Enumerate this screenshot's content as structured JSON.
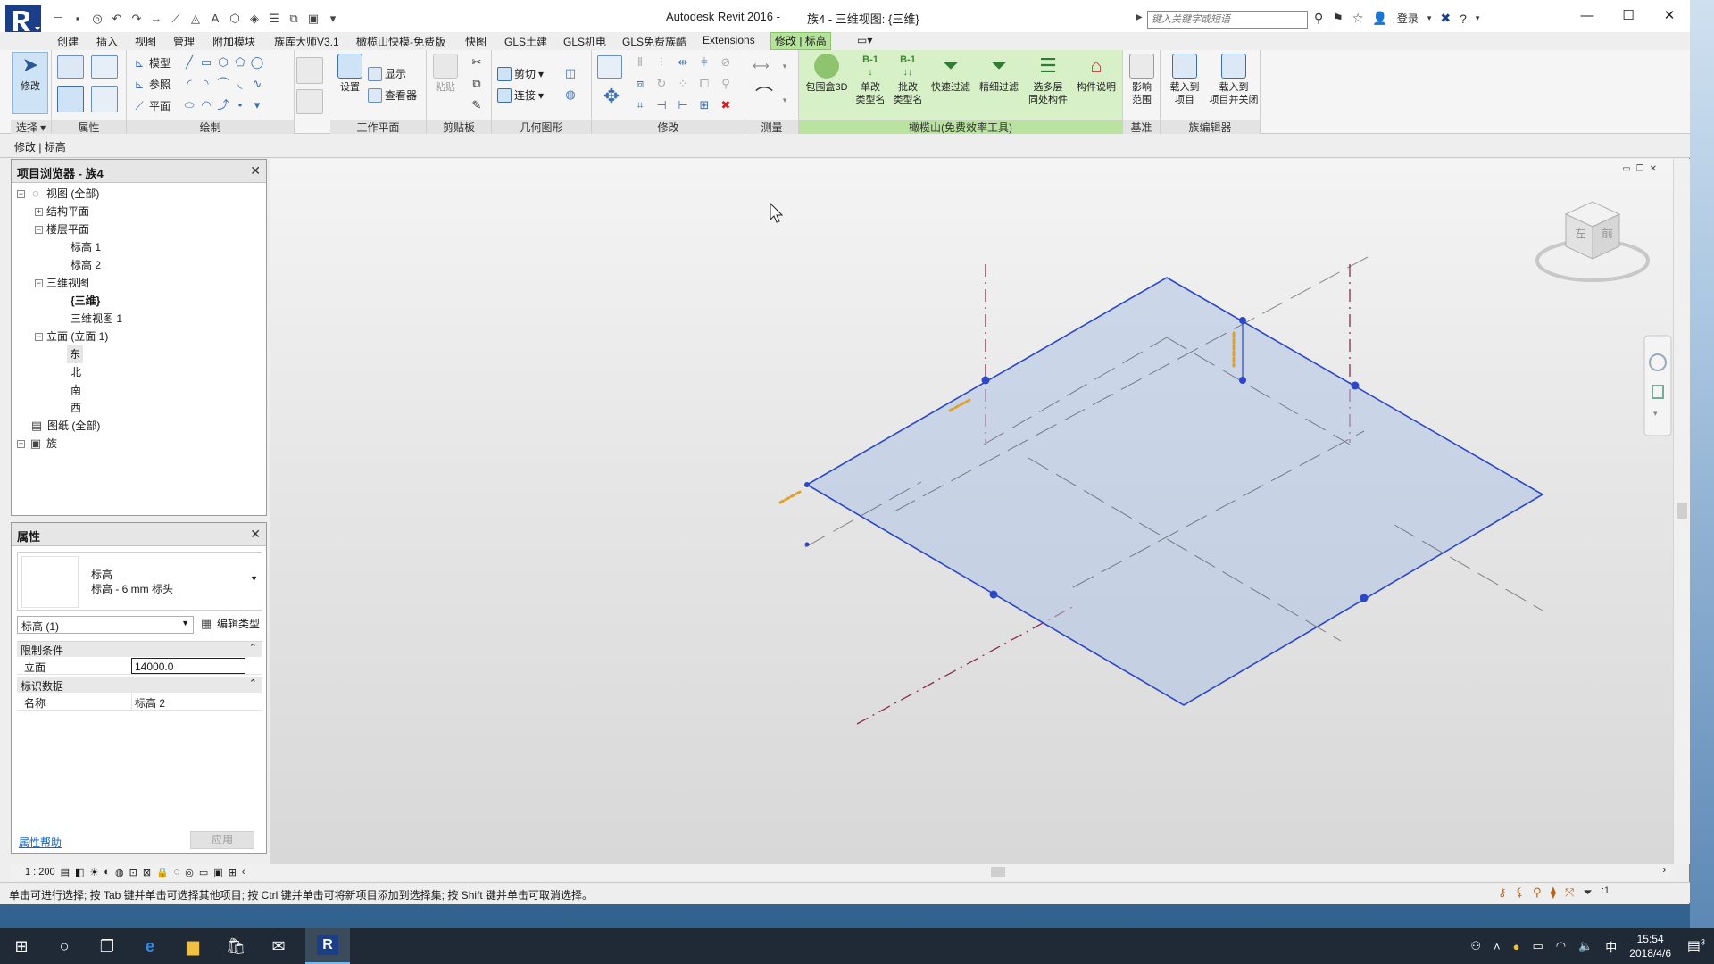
{
  "window": {
    "app_title": "Autodesk Revit 2016 -",
    "doc_title": "族4 - 三维视图: {三维}",
    "search_placeholder": "键入关键字或短语",
    "login_label": "登录",
    "help_label": "?"
  },
  "tabs": [
    {
      "label": "创建"
    },
    {
      "label": "插入"
    },
    {
      "label": "视图"
    },
    {
      "label": "管理"
    },
    {
      "label": "附加模块"
    },
    {
      "label": "族库大师V3.1"
    },
    {
      "label": "橄榄山快模-免费版"
    },
    {
      "label": "快图"
    },
    {
      "label": "GLS土建"
    },
    {
      "label": "GLS机电"
    },
    {
      "label": "GLS免费族酷"
    },
    {
      "label": "Extensions"
    },
    {
      "label": "修改 | 标高"
    }
  ],
  "ribbon": {
    "modify_label": "修改",
    "panels": {
      "select": "选择",
      "properties": "属性",
      "draw": "绘制",
      "workplane": "工作平面",
      "clipboard": "剪贴板",
      "geometry": "几何图形",
      "modify": "修改",
      "measure": "测量",
      "gls_tools": "橄榄山(免费效率工具)",
      "datum": "基准",
      "family_editor": "族编辑器"
    },
    "draw": {
      "model": "模型",
      "ref": "参照",
      "plane": "平面"
    },
    "workplane": {
      "set": "设置",
      "show": "显示",
      "viewer": "查看器"
    },
    "clipboard": {
      "paste": "粘贴"
    },
    "geometry": {
      "cut": "剪切",
      "join": "连接"
    },
    "gls_tools": {
      "box3d": "包围盒3D",
      "single_rename_1": "单改",
      "single_rename_2": "类型名",
      "batch_rename_1": "批改",
      "batch_rename_2": "类型名",
      "quick_filter": "快速过滤",
      "fine_filter": "精细过滤",
      "multi_level_1": "选多层",
      "multi_level_2": "同处构件",
      "component_desc": "构件说明"
    },
    "datum": {
      "influence_1": "影响",
      "influence_2": "范围"
    },
    "family_editor": {
      "load_1": "载入到",
      "load_2": "项目",
      "load_close_1": "载入到",
      "load_close_2": "项目并关闭"
    }
  },
  "context_bar": {
    "text": "修改 | 标高"
  },
  "project_browser": {
    "title": "项目浏览器 - 族4",
    "close": "✕",
    "items": [
      {
        "label": "视图 (全部)",
        "expander": "−"
      },
      {
        "label": "结构平面",
        "expander": "+"
      },
      {
        "label": "楼层平面",
        "expander": "−"
      },
      {
        "label": "标高 1"
      },
      {
        "label": "标高 2"
      },
      {
        "label": "三维视图",
        "expander": "−"
      },
      {
        "label": "{三维}"
      },
      {
        "label": "三维视图 1"
      },
      {
        "label": "立面 (立面 1)",
        "expander": "−"
      },
      {
        "label": "东"
      },
      {
        "label": "北"
      },
      {
        "label": "南"
      },
      {
        "label": "西"
      },
      {
        "label": "图纸 (全部)"
      },
      {
        "label": "族",
        "expander": "+"
      }
    ]
  },
  "properties": {
    "title": "属性",
    "close": "✕",
    "type_name_1": "标高",
    "type_name_2": "标高 - 6 mm 标头",
    "instance_selector": "标高 (1)",
    "edit_type": "编辑类型",
    "group_constraints": "限制条件",
    "elevation_label": "立面",
    "elevation_value": "14000.0",
    "group_identity": "标识数据",
    "name_label": "名称",
    "name_value": "标高 2",
    "help_link": "属性帮助",
    "apply": "应用"
  },
  "view_control": {
    "scale": "1 : 200"
  },
  "status": {
    "message": "单击可进行选择; 按 Tab 键并单击可选择其他项目; 按 Ctrl 键并单击可将新项目添加到选择集; 按 Shift 键并单击可取消选择。",
    "filter_count": ":1"
  },
  "view_cube": {
    "left_face": "左",
    "front_face": "前"
  },
  "taskbar": {
    "time": "15:54",
    "date": "2018/4/6",
    "ime": "中",
    "notif_count": "3"
  },
  "colors": {
    "ribbon_green": "#d7f0c8",
    "active_tab": "#b5e39a",
    "level_blue": "#2c47c8"
  }
}
